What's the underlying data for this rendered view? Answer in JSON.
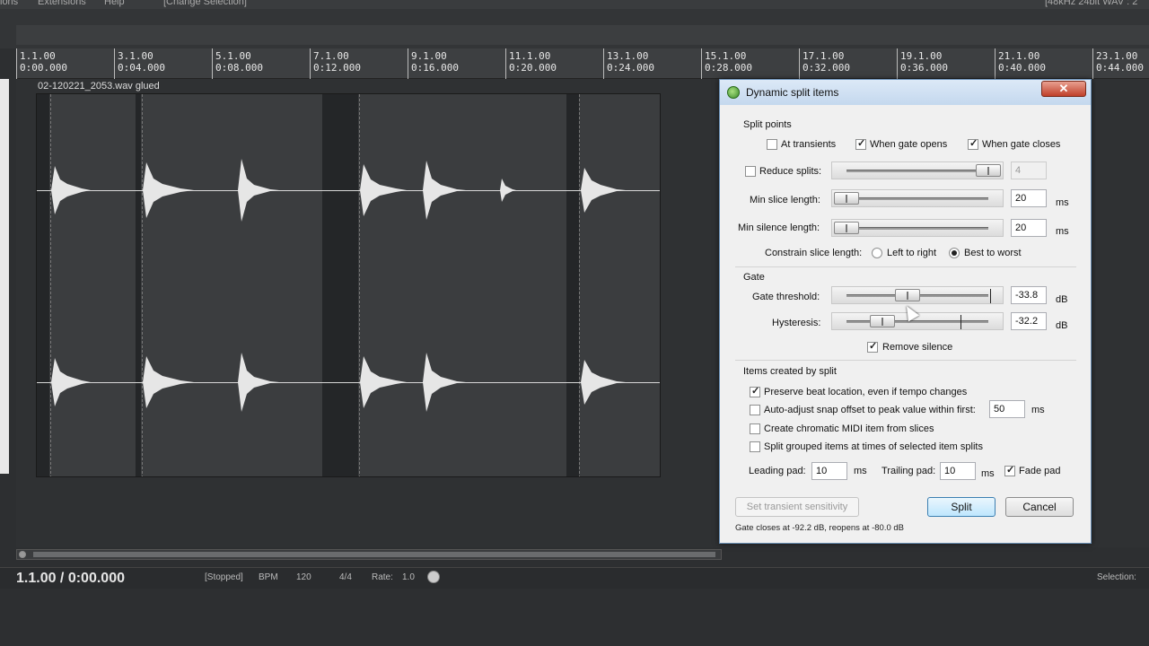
{
  "menubar": {
    "items": [
      "ions",
      "Extensions",
      "Help",
      "[Change Selection]"
    ],
    "right_info": "[48kHz 24bit WAV : 2"
  },
  "ruler": [
    {
      "m": "1.1.00",
      "t": "0:00.000"
    },
    {
      "m": "3.1.00",
      "t": "0:04.000"
    },
    {
      "m": "5.1.00",
      "t": "0:08.000"
    },
    {
      "m": "7.1.00",
      "t": "0:12.000"
    },
    {
      "m": "9.1.00",
      "t": "0:16.000"
    },
    {
      "m": "11.1.00",
      "t": "0:20.000"
    },
    {
      "m": "13.1.00",
      "t": "0:24.000"
    },
    {
      "m": "15.1.00",
      "t": "0:28.000"
    },
    {
      "m": "17.1.00",
      "t": "0:32.000"
    },
    {
      "m": "19.1.00",
      "t": "0:36.000"
    },
    {
      "m": "21.1.00",
      "t": "0:40.000"
    },
    {
      "m": "23.1.00",
      "t": "0:44.000"
    }
  ],
  "item": {
    "name": "02-120221_2053.wav glued"
  },
  "transport": {
    "position": "1.1.00 / 0:00.000",
    "state": "[Stopped]",
    "bpm_label": "BPM",
    "bpm": "120",
    "timesig": "4/4",
    "rate_label": "Rate:",
    "rate": "1.0",
    "selection_label": "Selection:"
  },
  "dialog": {
    "title": "Dynamic split items",
    "close": "✕",
    "split_points": {
      "group": "Split points",
      "at_transients": "At transients",
      "gate_opens": "When gate opens",
      "gate_closes": "When gate closes",
      "reduce_splits": "Reduce splits:",
      "reduce_value": "4",
      "min_slice": "Min slice length:",
      "min_slice_value": "20",
      "min_silence": "Min silence length:",
      "min_silence_value": "20",
      "unit_ms": "ms",
      "constrain": "Constrain slice length:",
      "left_to_right": "Left to right",
      "best_to_worst": "Best to worst"
    },
    "gate": {
      "group": "Gate",
      "threshold": "Gate threshold:",
      "threshold_value": "-33.8",
      "hysteresis": "Hysteresis:",
      "hysteresis_value": "-32.2",
      "unit_db": "dB",
      "remove_silence": "Remove silence"
    },
    "items": {
      "group": "Items created by split",
      "preserve_beat": "Preserve beat location, even if tempo changes",
      "auto_adjust": "Auto-adjust snap offset to peak value within first:",
      "auto_adjust_value": "50",
      "chromatic_midi": "Create chromatic MIDI item from slices",
      "split_grouped": "Split grouped items at times of selected item splits",
      "leading_pad": "Leading pad:",
      "leading_value": "10",
      "trailing_pad": "Trailing pad:",
      "trailing_value": "10",
      "fade_pad": "Fade pad"
    },
    "buttons": {
      "transient": "Set transient sensitivity",
      "split": "Split",
      "cancel": "Cancel"
    },
    "status": "Gate closes at -92.2 dB, reopens at -80.0 dB"
  }
}
